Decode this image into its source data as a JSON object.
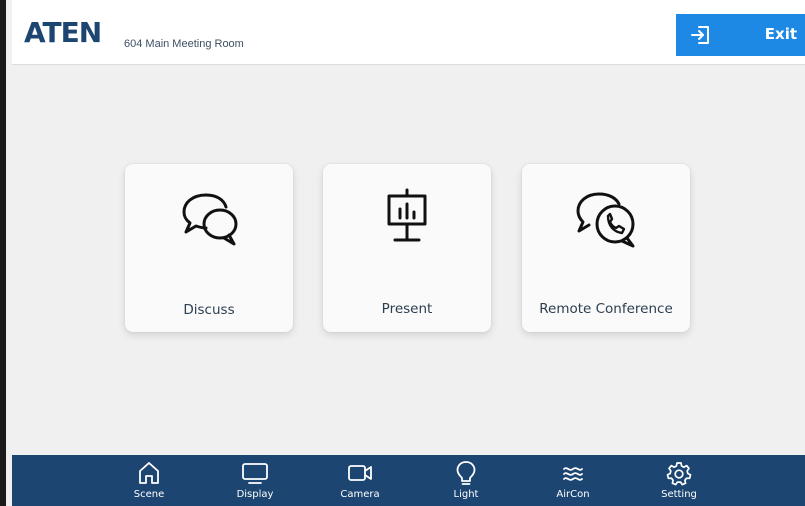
{
  "header": {
    "brand": "ATEN",
    "room_name": "604 Main Meeting Room",
    "exit_label": "Exit"
  },
  "scenes": [
    {
      "label": "Discuss",
      "icon": "chat-bubbles-icon"
    },
    {
      "label": "Present",
      "icon": "presentation-board-icon"
    },
    {
      "label": "Remote Conference",
      "icon": "phone-chat-icon"
    }
  ],
  "nav": [
    {
      "label": "Scene",
      "icon": "home-icon"
    },
    {
      "label": "Display",
      "icon": "monitor-icon"
    },
    {
      "label": "Camera",
      "icon": "video-camera-icon"
    },
    {
      "label": "Light",
      "icon": "lightbulb-icon"
    },
    {
      "label": "AirCon",
      "icon": "airflow-icon"
    },
    {
      "label": "Setting",
      "icon": "gear-icon"
    }
  ],
  "colors": {
    "header_bg": "#ffffff",
    "content_bg": "#f0f0f0",
    "exit_bg": "#1e88e5",
    "nav_bg": "#1d4572",
    "brand": "#1d4572"
  }
}
